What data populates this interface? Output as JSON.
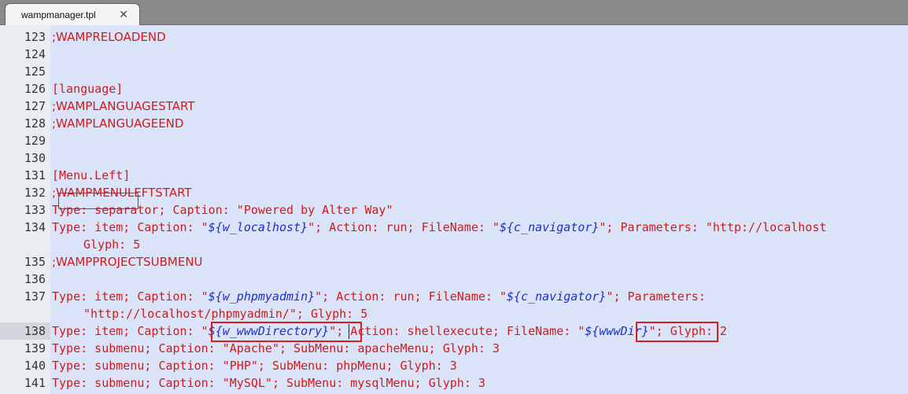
{
  "tab": {
    "title": "wampmanager.tpl",
    "close": "✕"
  },
  "line_numbers": [
    "123",
    "124",
    "125",
    "126",
    "127",
    "128",
    "129",
    "130",
    "131",
    "132",
    "133",
    "134",
    "135",
    "136",
    "137",
    "138",
    "139",
    "140",
    "141"
  ],
  "code": {
    "l123": ";WAMPRELOADEND",
    "l126": "[language]",
    "l127": ";WAMPLANGUAGESTART",
    "l128": ";WAMPLANGUAGEEND",
    "l131a": "[",
    "l131b": "Menu.Left",
    "l131c": "]",
    "l132": ";WAMPMENULEFTSTART",
    "l133": "Type: separator; Caption: \"Powered by Alter Way\"",
    "l134a": "Type: item; Caption: \"",
    "l134v1": "${w_localhost}",
    "l134b": "\"; Action: run; FileName: \"",
    "l134v2": "${c_navigator}",
    "l134c": "\"; Parameters: \"http://localhost",
    "l134d": "Glyph: 5",
    "l135": ";WAMPPROJECTSUBMENU",
    "l137a": "Type: item; Caption: \"",
    "l137v1": "${w_phpmyadmin}",
    "l137b": "\"; Action: run; FileName: \"",
    "l137v2": "${c_navigator}",
    "l137c": "\"; Parameters:",
    "l137d": "\"http://localhost/phpmyadmin/\"; Glyph: 5",
    "l138a": "Type: item; Caption: ",
    "l138q1": "\"",
    "l138v1": "${w_wwwDirectory}",
    "l138b": "\"; Action: shellexecute; FileName: ",
    "l138q2": "\"",
    "l138v2": "${wwwDir}",
    "l138q3": "\"",
    "l138c": "; Glyph: 2",
    "l139": "Type: submenu; Caption: \"Apache\"; SubMenu: apacheMenu; Glyph: 3",
    "l140": "Type: submenu; Caption: \"PHP\"; SubMenu: phpMenu; Glyph: 3",
    "l141": "Type: submenu; Caption: \"MySQL\"; SubMenu: mysqlMenu; Glyph: 3"
  },
  "colors": {
    "background": "#dbe3f8",
    "text": "#cc1c1c",
    "variable": "#1d2fc8",
    "highlight_box": "#d81f1f"
  }
}
